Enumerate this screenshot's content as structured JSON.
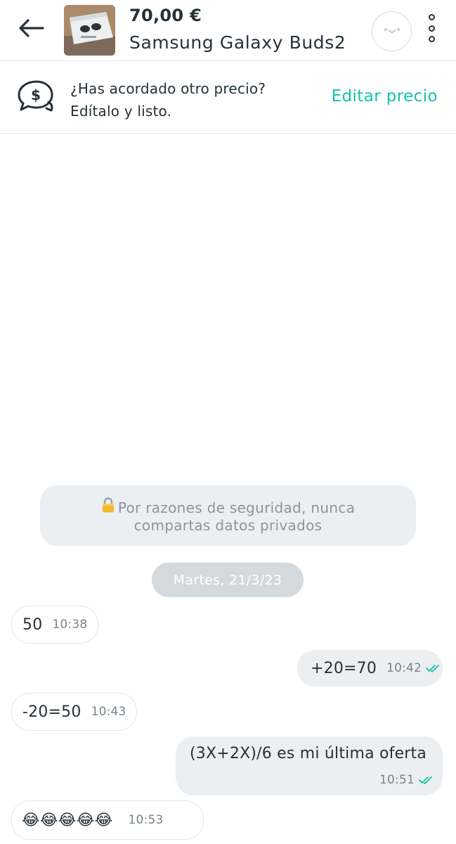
{
  "header": {
    "price": "70,00 €",
    "title": "Samsung Galaxy Buds2",
    "back_icon": "arrow-left-icon",
    "avatar_icon": "smiley-face-icon",
    "more_icon": "vertical-dots-icon"
  },
  "banner": {
    "icon": "chat-bubbles-dollar-icon",
    "line1": "¿Has acordado otro precio?",
    "line2": "Edítalo y listo.",
    "action": "Editar precio"
  },
  "chat": {
    "security_notice": "Por razones de seguridad, nunca compartas datos privados",
    "security_icon": "lock-icon",
    "date_separator": "Martes, 21/3/23",
    "messages": [
      {
        "direction": "in",
        "text": "50",
        "time": "10:38"
      },
      {
        "direction": "out",
        "text": "+20=70",
        "time": "10:42",
        "status": "read"
      },
      {
        "direction": "in",
        "text": "-20=50",
        "time": "10:43"
      },
      {
        "direction": "out",
        "text": "(3X+2X)/6 es mi última oferta",
        "time": "10:51",
        "status": "read"
      },
      {
        "direction": "in",
        "text": "😂😂😂😂😂",
        "time": "10:53"
      }
    ]
  },
  "colors": {
    "accent": "#13c1ac",
    "text": "#253238",
    "bubble_out": "#eceff1",
    "date_chip": "#d3d9dd",
    "read_check": "#13c1ac"
  }
}
